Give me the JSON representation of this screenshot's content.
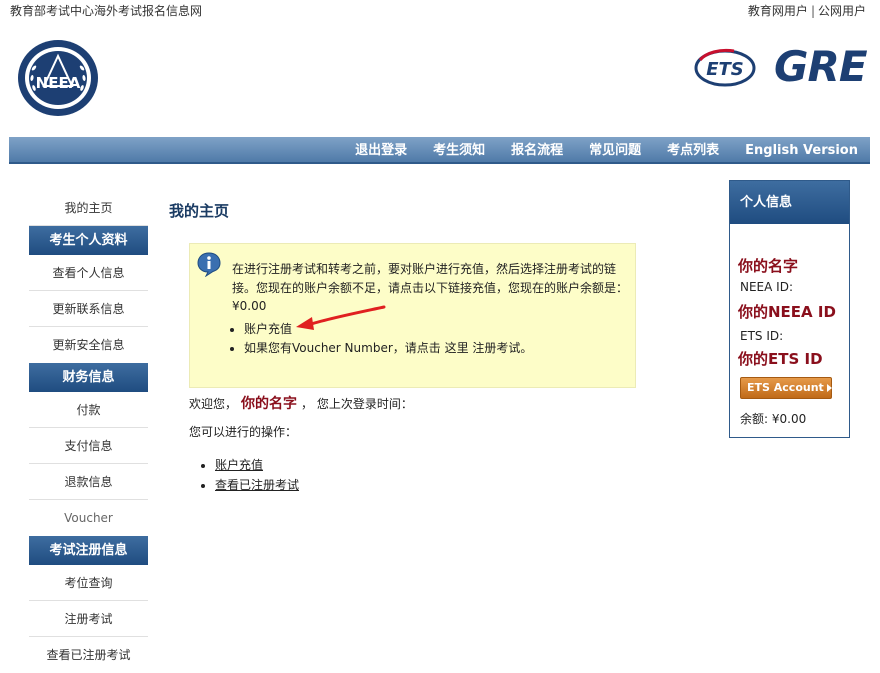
{
  "header": {
    "site_title": "教育部考试中心海外考试报名信息网",
    "user_link_1": "教育网用户",
    "separator": "|",
    "user_link_2": "公网用户",
    "neea_logo_text": "NEEA",
    "ets_logo_text": "ETS",
    "gre_logo_text": "GRE"
  },
  "nav": [
    "退出登录",
    "考生须知",
    "报名流程",
    "常见问题",
    "考点列表",
    "English Version"
  ],
  "sidebar": {
    "home": "我的主页",
    "section1": "考生个人资料",
    "items1": [
      "查看个人信息",
      "更新联系信息",
      "更新安全信息"
    ],
    "section2": "财务信息",
    "items2": [
      "付款",
      "支付信息",
      "退款信息",
      "Voucher"
    ],
    "section3": "考试注册信息",
    "items3": [
      "考位查询",
      "注册考试",
      "查看已注册考试"
    ]
  },
  "main": {
    "title": "我的主页",
    "notice_text": "在进行注册考试和转考之前，要对账户进行充值，然后选择注册考试的链接。您现在的账户余额不足，请点击以下链接充值，您现在的账户余额是：¥0.00",
    "notice_items": [
      "账户充值",
      "如果您有Voucher Number，请点击 这里 注册考试。"
    ],
    "welcome_prefix": "欢迎您，",
    "welcome_name": "你的名字",
    "welcome_suffix": "， 您上次登录时间：",
    "ops_label": "您可以进行的操作：",
    "ops": [
      "账户充值",
      "查看已注册考试"
    ]
  },
  "profile": {
    "header": "个人信息",
    "name": "你的名字",
    "neea_label": "NEEA ID:",
    "neea_value": "你的NEEA ID",
    "ets_label": "ETS ID:",
    "ets_value": "你的ETS ID",
    "ets_button": "ETS Account",
    "balance": "余额: ¥0.00"
  },
  "colors": {
    "nav_blue": "#4f7aa8",
    "header_blue": "#1f4c80",
    "name_red": "#8a0f1c",
    "notice_yellow": "#fdfdc8",
    "ets_orange": "#c06a18"
  }
}
